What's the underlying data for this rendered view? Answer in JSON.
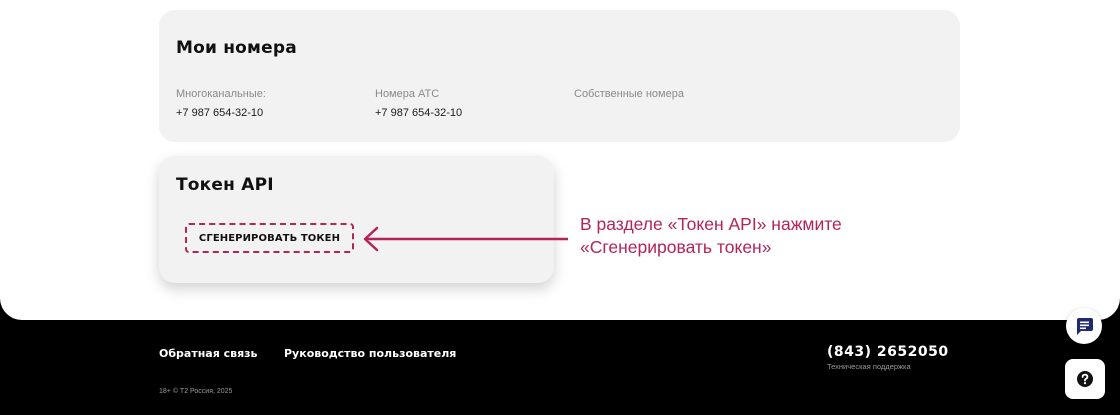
{
  "numbers": {
    "title": "Мои номера",
    "columns": [
      {
        "label": "Многоканальные:",
        "value": "+7 987 654-32-10"
      },
      {
        "label": "Номера АТС",
        "value": "+7 987 654-32-10"
      },
      {
        "label": "Собственные номера",
        "value": ""
      }
    ]
  },
  "token": {
    "title": "Токен API",
    "generate_label": "СГЕНЕРИРОВАТЬ ТОКЕН"
  },
  "hint": {
    "line1": "В разделе «Токен API» нажмите",
    "line2": "«Сгенерировать токен»"
  },
  "footer": {
    "links": [
      "Обратная связь",
      "Руководство пользователя"
    ],
    "copyright": "18+ © Т2 Россия, 2025",
    "phone": "(843) 2652050",
    "support": "Техническая поддержка"
  },
  "widgets": {
    "chat_icon": "chat-icon",
    "help_icon": "question-icon"
  },
  "colors": {
    "accent": "#b3245a",
    "card": "#f2f2f2",
    "footer": "#000000"
  }
}
